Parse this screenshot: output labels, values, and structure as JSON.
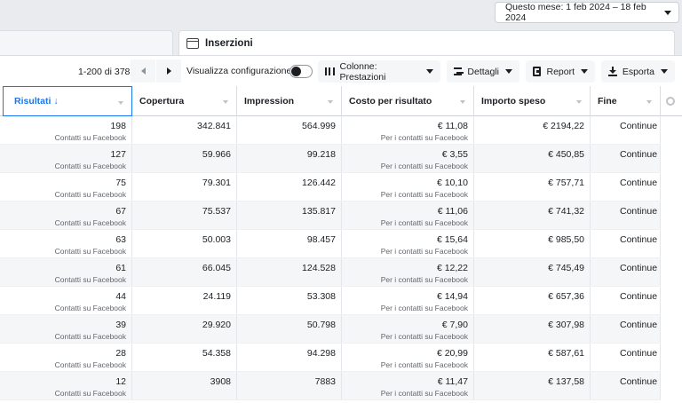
{
  "date_range": {
    "label": "Questo mese: 1 feb 2024 – 18 feb 2024"
  },
  "tab": {
    "label": "Inserzioni"
  },
  "toolbar": {
    "range": "1-200 di 378",
    "view_config": "Visualizza configurazione",
    "columns": "Colonne: Prestazioni",
    "details": "Dettagli",
    "report": "Report",
    "export": "Esporta"
  },
  "columns": [
    {
      "label": "Risultati ↓",
      "sorted": true
    },
    {
      "label": "Copertura"
    },
    {
      "label": "Impression"
    },
    {
      "label": "Costo per risultato"
    },
    {
      "label": "Importo speso"
    },
    {
      "label": "Fine"
    }
  ],
  "rows": [
    {
      "results": "198",
      "results_sub": "Contatti su Facebook",
      "reach": "342.841",
      "impressions": "564.999",
      "cpr": "€ 11,08",
      "cpr_sub": "Per i contatti su Facebook",
      "spent": "€ 2194,22",
      "end": "Continue"
    },
    {
      "results": "127",
      "results_sub": "Contatti su Facebook",
      "reach": "59.966",
      "impressions": "99.218",
      "cpr": "€ 3,55",
      "cpr_sub": "Per i contatti su Facebook",
      "spent": "€ 450,85",
      "end": "Continue"
    },
    {
      "results": "75",
      "results_sub": "Contatti su Facebook",
      "reach": "79.301",
      "impressions": "126.442",
      "cpr": "€ 10,10",
      "cpr_sub": "Per i contatti su Facebook",
      "spent": "€ 757,71",
      "end": "Continue"
    },
    {
      "results": "67",
      "results_sub": "Contatti su Facebook",
      "reach": "75.537",
      "impressions": "135.817",
      "cpr": "€ 11,06",
      "cpr_sub": "Per i contatti su Facebook",
      "spent": "€ 741,32",
      "end": "Continue"
    },
    {
      "results": "63",
      "results_sub": "Contatti su Facebook",
      "reach": "50.003",
      "impressions": "98.457",
      "cpr": "€ 15,64",
      "cpr_sub": "Per i contatti su Facebook",
      "spent": "€ 985,50",
      "end": "Continue"
    },
    {
      "results": "61",
      "results_sub": "Contatti su Facebook",
      "reach": "66.045",
      "impressions": "124.528",
      "cpr": "€ 12,22",
      "cpr_sub": "Per i contatti su Facebook",
      "spent": "€ 745,49",
      "end": "Continue"
    },
    {
      "results": "44",
      "results_sub": "Contatti su Facebook",
      "reach": "24.119",
      "impressions": "53.308",
      "cpr": "€ 14,94",
      "cpr_sub": "Per i contatti su Facebook",
      "spent": "€ 657,36",
      "end": "Continue"
    },
    {
      "results": "39",
      "results_sub": "Contatti su Facebook",
      "reach": "29.920",
      "impressions": "50.798",
      "cpr": "€ 7,90",
      "cpr_sub": "Per i contatti su Facebook",
      "spent": "€ 307,98",
      "end": "Continue"
    },
    {
      "results": "28",
      "results_sub": "Contatti su Facebook",
      "reach": "54.358",
      "impressions": "94.298",
      "cpr": "€ 20,99",
      "cpr_sub": "Per i contatti su Facebook",
      "spent": "€ 587,61",
      "end": "Continue"
    },
    {
      "results": "12",
      "results_sub": "Contatti su Facebook",
      "reach": "3908",
      "impressions": "7883",
      "cpr": "€ 11,47",
      "cpr_sub": "Per i contatti su Facebook",
      "spent": "€ 137,58",
      "end": "Continue"
    }
  ],
  "colors": {
    "accent": "#1877f2",
    "row_alt": "#f5f6f7",
    "border": "#dadde1"
  },
  "icons": [
    "calendar-tab-icon",
    "columns-icon",
    "details-icon",
    "report-icon",
    "export-icon",
    "settings-gear-icon"
  ]
}
